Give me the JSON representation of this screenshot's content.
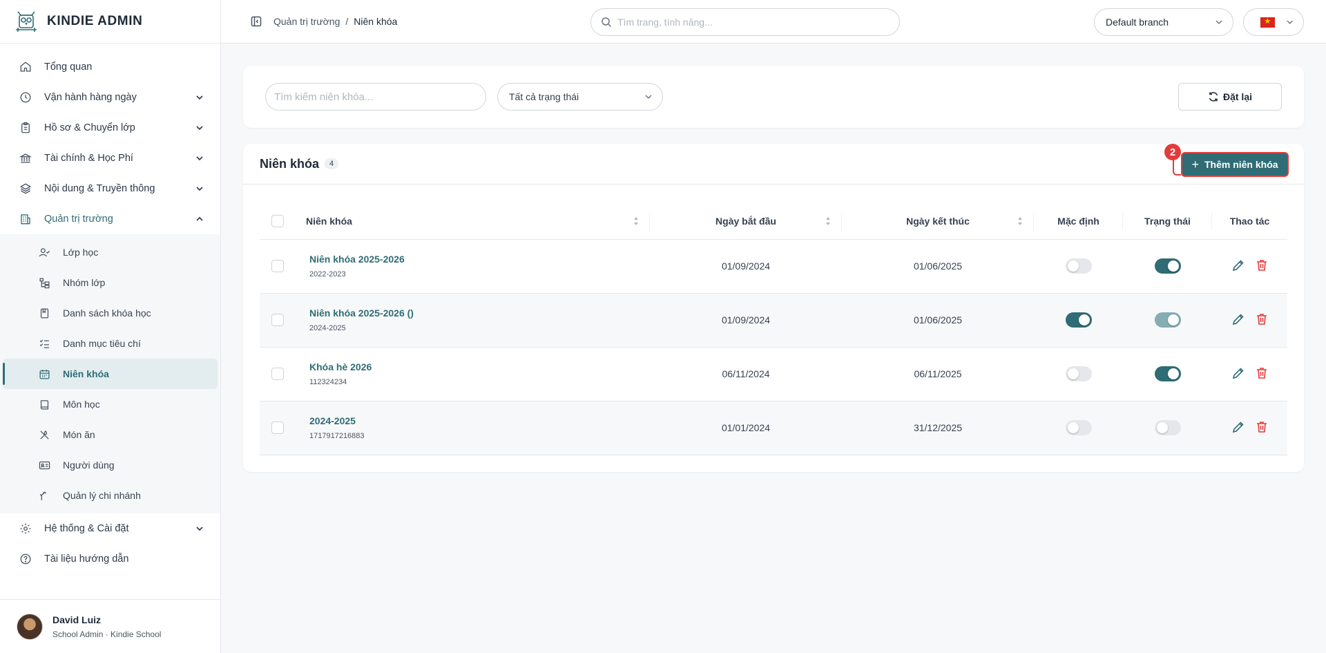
{
  "brand": {
    "name": "KINDIE ADMIN"
  },
  "sidebar": {
    "items": [
      {
        "label": "Tổng quan"
      },
      {
        "label": "Vận hành hàng ngày"
      },
      {
        "label": "Hồ sơ & Chuyển lớp"
      },
      {
        "label": "Tài chính & Học Phí"
      },
      {
        "label": "Nội dung & Truyền thông"
      },
      {
        "label": "Quản trị trường"
      },
      {
        "label": "Hệ thống & Cài đặt"
      },
      {
        "label": "Tài liệu hướng dẫn"
      }
    ],
    "sub_items": [
      {
        "label": "Lớp học"
      },
      {
        "label": "Nhóm lớp"
      },
      {
        "label": "Danh sách khóa học"
      },
      {
        "label": "Danh mục tiêu chí"
      },
      {
        "label": "Niên khóa"
      },
      {
        "label": "Môn học"
      },
      {
        "label": "Món ăn"
      },
      {
        "label": "Người dùng"
      },
      {
        "label": "Quản lý chi nhánh"
      }
    ]
  },
  "user": {
    "name": "David Luiz",
    "role": "School Admin · Kindie School"
  },
  "header": {
    "breadcrumb": [
      "Quản trị trường",
      "/",
      "Niên khóa"
    ],
    "search_placeholder": "Tìm trang, tính năng...",
    "branch": "Default branch"
  },
  "filters": {
    "search_placeholder": "Tìm kiếm niên khóa...",
    "status": "Tất cả trạng thái",
    "reset_label": "Đặt lại"
  },
  "table_card": {
    "title": "Niên khóa",
    "count": "4",
    "add_label": "Thêm niên khóa",
    "annotation": "2",
    "columns": [
      "Niên khóa",
      "Ngày bắt đầu",
      "Ngày kết thúc",
      "Mặc định",
      "Trạng thái",
      "Thao tác"
    ],
    "rows": [
      {
        "name": "Niên khóa 2025-2026",
        "code": "2022-2023",
        "start": "01/09/2024",
        "end": "01/06/2025",
        "default": false,
        "status": true
      },
      {
        "name": "Niên khóa 2025-2026 ()",
        "code": "2024-2025",
        "start": "01/09/2024",
        "end": "01/06/2025",
        "default": true,
        "status": true
      },
      {
        "name": "Khóa hè 2026",
        "code": "112324234",
        "start": "06/11/2024",
        "end": "06/11/2025",
        "default": false,
        "status": true
      },
      {
        "name": "2024-2025",
        "code": "1717917216883",
        "start": "01/01/2024",
        "end": "31/12/2025",
        "default": false,
        "status": false
      }
    ]
  },
  "colors": {
    "accent": "#2f6c75",
    "annotation": "#e33b3b"
  }
}
